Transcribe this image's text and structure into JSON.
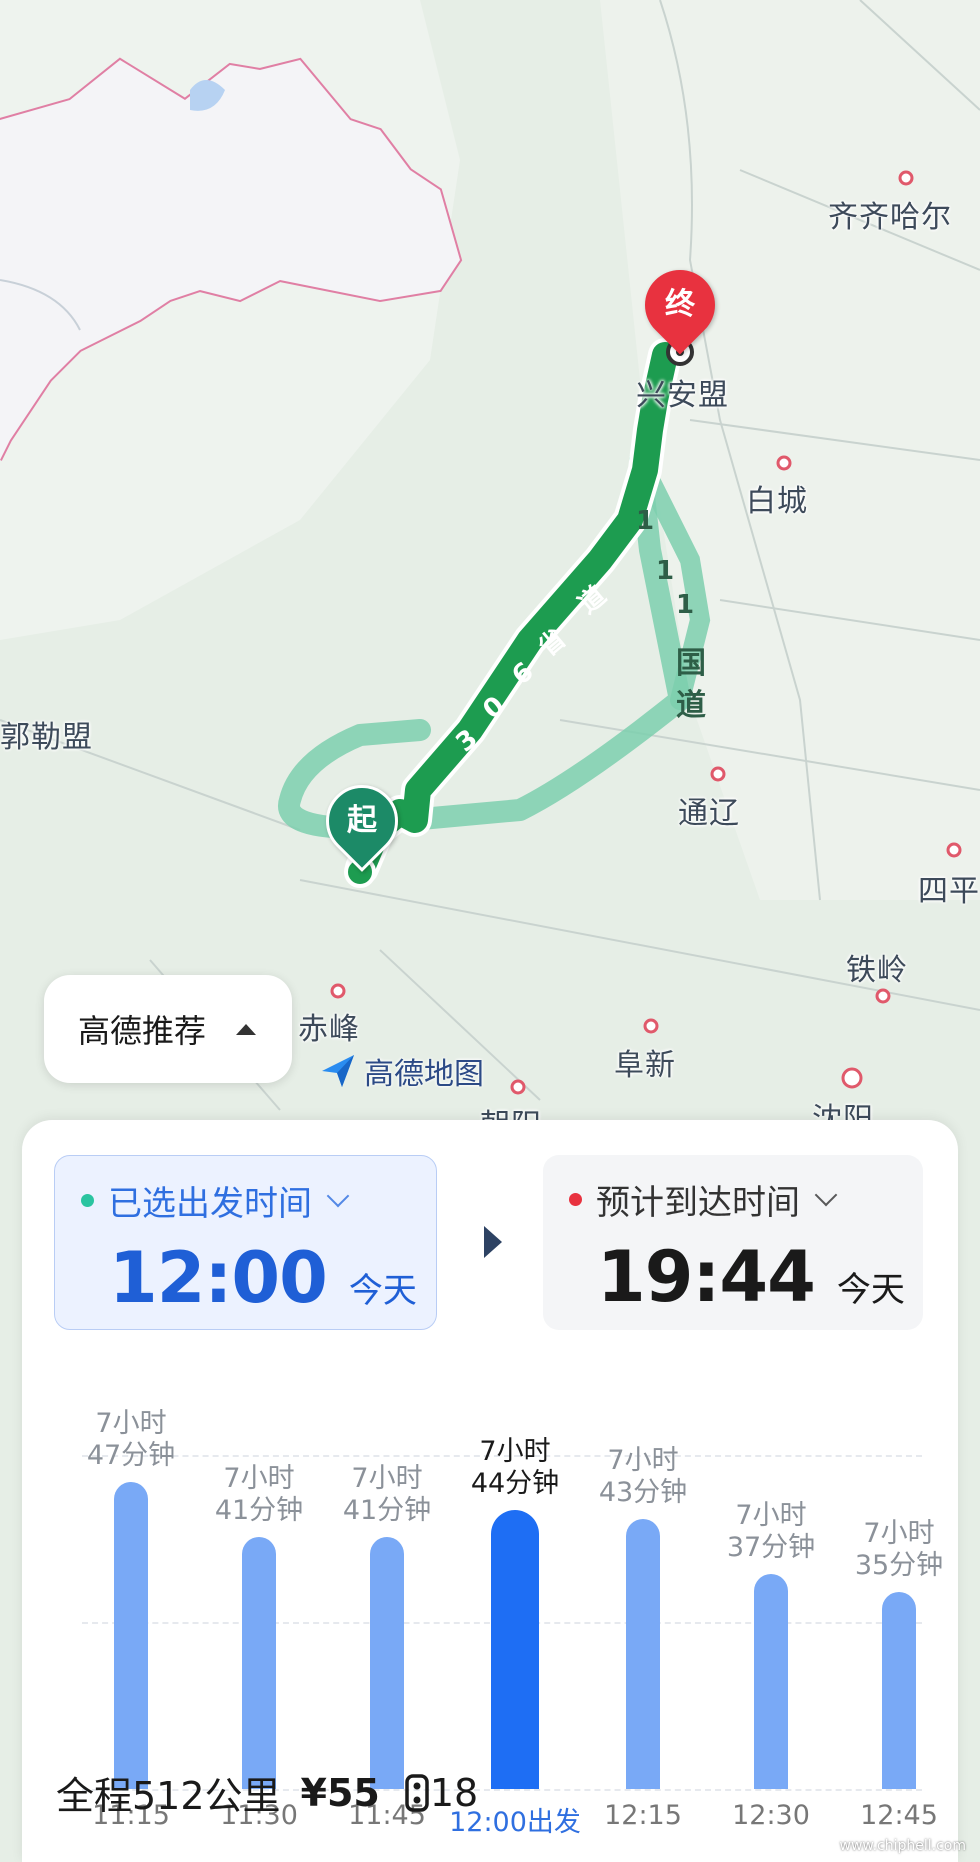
{
  "map": {
    "cities": {
      "qiqihar": "齐齐哈尔",
      "xinganmeng": "兴安盟",
      "baicheng": "白城",
      "tongliao": "通辽",
      "siping": "四平",
      "tieling": "铁岭",
      "chifeng": "赤峰",
      "fuxin": "阜新",
      "chaoyang": "朝阳",
      "shenyang": "沈阳",
      "xilinguole": "郭勒盟"
    },
    "road_main": [
      "3",
      "0",
      "6",
      "省",
      "道"
    ],
    "road_alt": [
      "1",
      "1",
      "1",
      "国",
      "道"
    ],
    "end_marker": "终",
    "start_marker": "起",
    "brand": "高德地图"
  },
  "recommend_chip": {
    "label": "高德推荐"
  },
  "depart": {
    "label": "已选出发时间",
    "time": "12:00",
    "day": "今天",
    "dot_color": "#2ac4a0"
  },
  "arrive": {
    "label": "预计到达时间",
    "time": "19:44",
    "day": "今天",
    "dot_color": "#e8323f"
  },
  "chart_data": {
    "type": "bar",
    "categories": [
      "11:15",
      "11:30",
      "11:45",
      "12:00出发",
      "12:15",
      "12:30",
      "12:45"
    ],
    "values": [
      467,
      461,
      461,
      464,
      463,
      457,
      455
    ],
    "duration_labels": [
      [
        "7小时",
        "47分钟"
      ],
      [
        "7小时",
        "41分钟"
      ],
      [
        "7小时",
        "41分钟"
      ],
      [
        "7小时",
        "44分钟"
      ],
      [
        "7小时",
        "43分钟"
      ],
      [
        "7小时",
        "37分钟"
      ],
      [
        "7小时",
        "35分钟"
      ]
    ],
    "selected_index": 3,
    "ylabel": "",
    "xlabel": "",
    "ylim": [
      0,
      480
    ]
  },
  "summary": {
    "distance": "全程512公里",
    "toll": "¥55",
    "lights": "18"
  },
  "colors": {
    "route_main": "#1d9c50",
    "route_alt": "#7ccfae",
    "accent": "#1e6ef4",
    "bar": "#79a9f6"
  }
}
